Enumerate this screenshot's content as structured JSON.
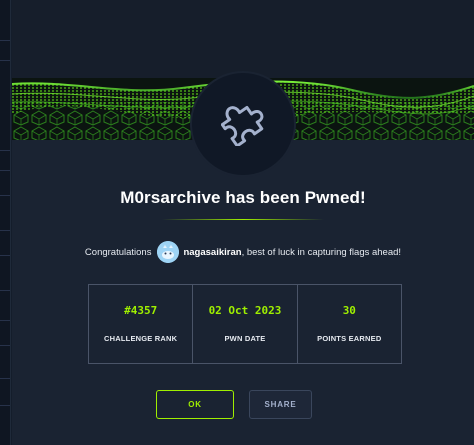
{
  "modal": {
    "title": "M0rsarchive has been Pwned!",
    "congrats_prefix": "Congratulations",
    "username": "nagasaikiran",
    "congrats_suffix": ", best of luck in capturing flags ahead!",
    "badge_icon": "puzzle-piece-icon",
    "avatar_icon": "user-avatar-icon",
    "accent_color": "#9fef00",
    "background_color": "#1a2332"
  },
  "stats": [
    {
      "value": "#4357",
      "label": "CHALLENGE RANK"
    },
    {
      "value": "02 Oct 2023",
      "label": "PWN DATE"
    },
    {
      "value": "30",
      "label": "POINTS EARNED"
    }
  ],
  "buttons": {
    "ok_label": "OK",
    "share_label": "SHARE"
  }
}
